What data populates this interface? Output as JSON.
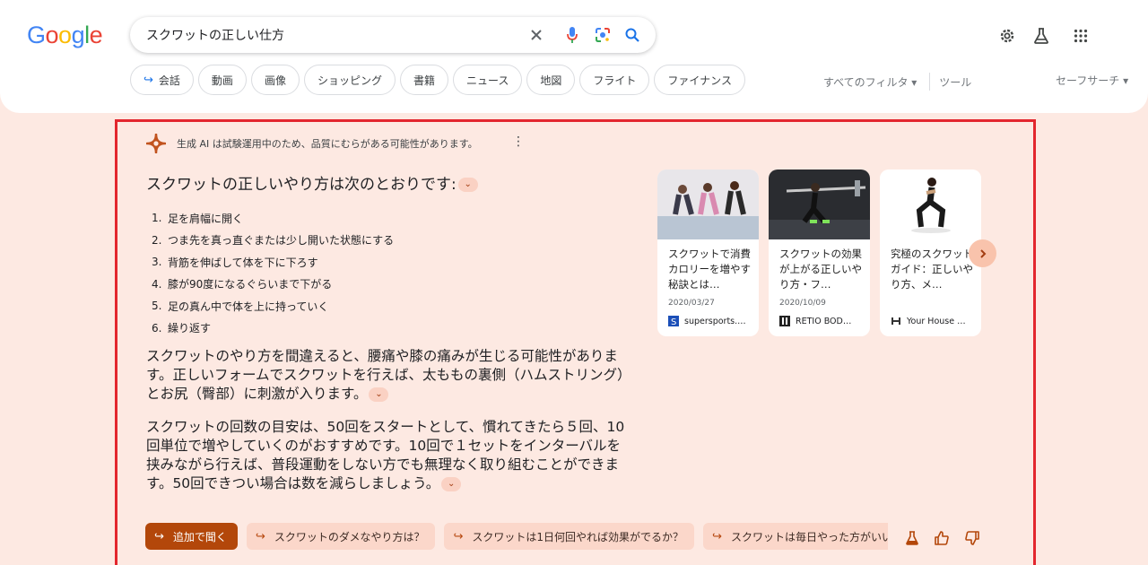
{
  "logo": {
    "letters": [
      "G",
      "o",
      "o",
      "g",
      "l",
      "e"
    ],
    "colors": [
      "#4285f4",
      "#ea4335",
      "#fbbc05",
      "#4285f4",
      "#34a853",
      "#ea4335"
    ]
  },
  "search": {
    "query": "スクワットの正しい仕方"
  },
  "chips": [
    "会話",
    "動画",
    "画像",
    "ショッピング",
    "書籍",
    "ニュース",
    "地図",
    "フライト",
    "ファイナンス"
  ],
  "filters": {
    "all_filters": "すべてのフィルタ ▾",
    "tools": "ツール",
    "safesearch": "セーフサーチ ▾"
  },
  "ai": {
    "disclaimer": "生成 AI は試験運用中のため、品質にむらがある可能性があります。",
    "intro": "スクワットの正しいやり方は次のとおりです:",
    "steps": [
      "足を肩幅に開く",
      "つま先を真っ直ぐまたは少し開いた状態にする",
      "背筋を伸ばして体を下に下ろす",
      "膝が90度になるぐらいまで下がる",
      "足の真ん中で体を上に持っていく",
      "繰り返す"
    ],
    "para1": "スクワットのやり方を間違えると、腰痛や膝の痛みが生じる可能性があります。正しいフォームでスクワットを行えば、太ももの裏側（ハムストリング）とお尻（臀部）に刺激が入ります。",
    "para2": "スクワットの回数の目安は、50回をスタートとして、慣れてきたら５回、10回単位で増やしていくのがおすすめです。10回で１セットをインターバルを挟みながら行えば、普段運動をしない方でも無理なく取り組むことができます。50回できつい場合は数を減らしましょう。",
    "followups": [
      "追加で聞く",
      "スクワットのダメなやり方は？",
      "スクワットは1日何回やれば効果がでるか？",
      "スクワットは毎日やった方がいい"
    ]
  },
  "cards": [
    {
      "title": "スクワットで消費カロリーを増やす秘訣とは…",
      "date": "2020/03/27",
      "source": "supersports.…"
    },
    {
      "title": "スクワットの効果が上がる正しいやり方・フ…",
      "date": "2020/10/09",
      "source": "RETIO BOD…"
    },
    {
      "title": "究極のスクワットガイド：正しいやり方、メ…",
      "date": "",
      "source": "Your House …"
    }
  ],
  "colors": {
    "accent": "#b3470a",
    "panel_bg": "#fde9e2",
    "highlight_border": "#e3262e"
  }
}
